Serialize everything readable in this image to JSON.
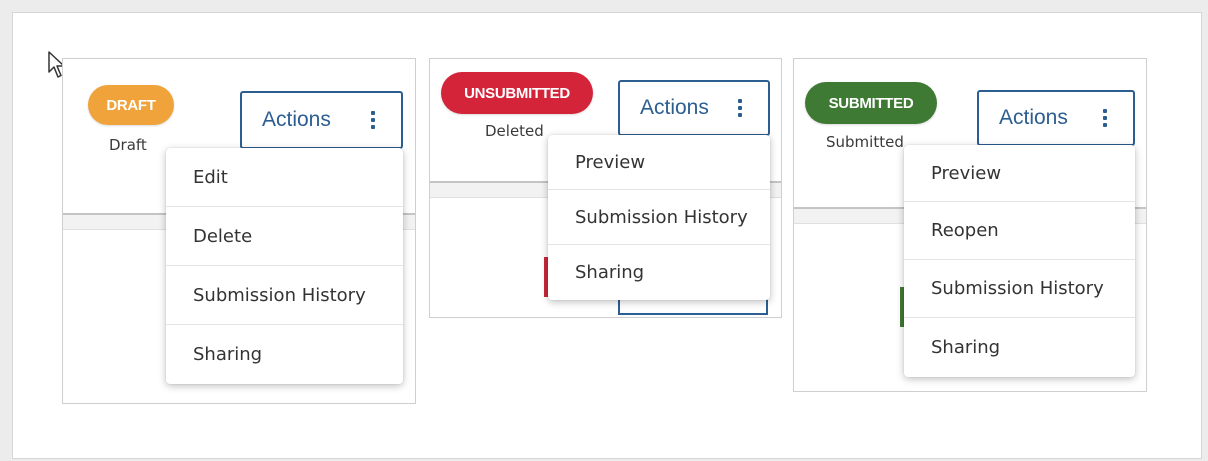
{
  "cards": [
    {
      "id": "draft",
      "badge": {
        "label": "DRAFT",
        "color": "#f0a23b"
      },
      "status_text": "Draft",
      "actions_label": "Actions",
      "menu": [
        "Edit",
        "Delete",
        "Submission History",
        "Sharing"
      ]
    },
    {
      "id": "unsubmitted",
      "badge": {
        "label": "UNSUBMITTED",
        "color": "#d4243a"
      },
      "status_text": "Deleted",
      "actions_label": "Actions",
      "menu": [
        "Preview",
        "Submission History",
        "Sharing"
      ]
    },
    {
      "id": "submitted",
      "badge": {
        "label": "SUBMITTED",
        "color": "#3f7a34"
      },
      "status_text": "Submitted",
      "actions_label": "Actions",
      "menu": [
        "Preview",
        "Reopen",
        "Submission History",
        "Sharing"
      ]
    }
  ],
  "icons": {
    "actions_menu": "kebab-vertical-icon",
    "pointer": "mouse-pointer-icon"
  }
}
